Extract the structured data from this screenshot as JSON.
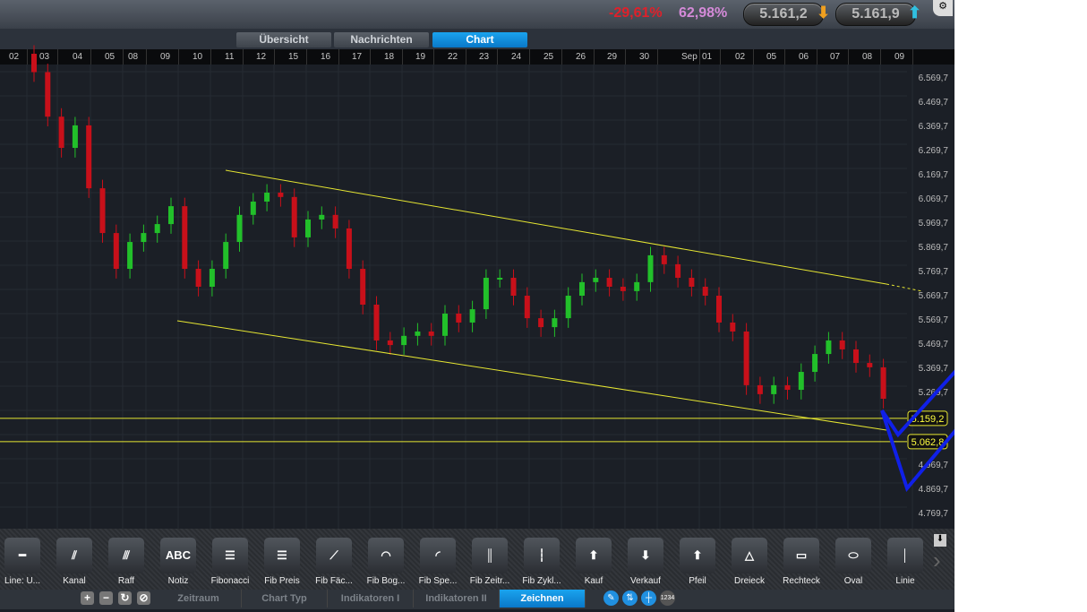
{
  "header": {
    "change_pct": "-29,61%",
    "change_color": "#e0202a",
    "ratio_pct": "62,98%",
    "ratio_color": "#d48ad8",
    "bid": "5.161,2",
    "ask": "5.161,9"
  },
  "tabs": [
    {
      "label": "Übersicht"
    },
    {
      "label": "Nachrichten"
    },
    {
      "label": "Chart",
      "active": true
    }
  ],
  "dates": [
    "02",
    "03",
    "04",
    "05",
    "08",
    "09",
    "10",
    "11",
    "12",
    "15",
    "16",
    "17",
    "18",
    "19",
    "22",
    "23",
    "24",
    "25",
    "26",
    "29",
    "30",
    "Sep",
    "01",
    "02",
    "05",
    "06",
    "07",
    "08",
    "09"
  ],
  "price_axis": [
    "6.569,7",
    "6.469,7",
    "6.369,7",
    "6.269,7",
    "6.169,7",
    "6.069,7",
    "5.969,7",
    "5.869,7",
    "5.769,7",
    "5.669,7",
    "5.569,7",
    "5.469,7",
    "5.369,7",
    "5.269,7",
    "5.169,7",
    "5.069,7",
    "4.969,7",
    "4.869,7",
    "4.769,7"
  ],
  "price_levels": [
    {
      "label": "5.159,2",
      "value": 5159.2
    },
    {
      "label": "5.062,8",
      "value": 5062.8
    }
  ],
  "candle_closes": [
    6666,
    6590,
    6406,
    6277,
    6370,
    6110,
    5925,
    5777,
    5888,
    5925,
    5962,
    6036,
    5777,
    5703,
    5777,
    5888,
    6000,
    6055,
    6092,
    6074,
    5907,
    5981,
    6000,
    5944,
    5777,
    5629,
    5481,
    5462,
    5500,
    5518,
    5500,
    5592,
    5555,
    5610,
    5740,
    5740,
    5666,
    5573,
    5536,
    5573,
    5666,
    5722,
    5740,
    5703,
    5685,
    5722,
    5833,
    5796,
    5740,
    5703,
    5666,
    5555,
    5518,
    5296,
    5259,
    5296,
    5277,
    5351,
    5425,
    5481,
    5444,
    5388,
    5370,
    5240
  ],
  "colors": {
    "up": "#22c02a",
    "down": "#c8101a",
    "trendline": "#e6e632",
    "annotation": "#1020e8"
  },
  "tools": [
    {
      "label": "Line: U...",
      "icon": "horizontal-line-icon",
      "glyph": "━"
    },
    {
      "label": "Kanal",
      "icon": "channel-icon",
      "glyph": "⫽"
    },
    {
      "label": "Raff",
      "icon": "raff-channel-icon",
      "glyph": "⫻"
    },
    {
      "label": "Notiz",
      "icon": "note-icon",
      "glyph": "ABC"
    },
    {
      "label": "Fibonacci",
      "icon": "fibonacci-icon",
      "glyph": "☰"
    },
    {
      "label": "Fib Preis",
      "icon": "fib-price-icon",
      "glyph": "☰"
    },
    {
      "label": "Fib Fäc...",
      "icon": "fib-fan-icon",
      "glyph": "⟋"
    },
    {
      "label": "Fib Bog...",
      "icon": "fib-arc-icon",
      "glyph": "◠"
    },
    {
      "label": "Fib Spe...",
      "icon": "fib-speed-icon",
      "glyph": "◜"
    },
    {
      "label": "Fib Zeitr...",
      "icon": "fib-time-icon",
      "glyph": "║"
    },
    {
      "label": "Fib Zykl...",
      "icon": "fib-cycle-icon",
      "glyph": "┆"
    },
    {
      "label": "Kauf",
      "icon": "buy-arrow-icon",
      "glyph": "⬆"
    },
    {
      "label": "Verkauf",
      "icon": "sell-arrow-icon",
      "glyph": "⬇"
    },
    {
      "label": "Pfeil",
      "icon": "arrow-icon",
      "glyph": "⬆"
    },
    {
      "label": "Dreieck",
      "icon": "triangle-icon",
      "glyph": "△"
    },
    {
      "label": "Rechteck",
      "icon": "rectangle-icon",
      "glyph": "▭"
    },
    {
      "label": "Oval",
      "icon": "oval-icon",
      "glyph": "⬭"
    },
    {
      "label": "Linie",
      "icon": "vertical-line-icon",
      "glyph": "│"
    }
  ],
  "bottom_tabs": [
    {
      "label": "Zeitraum"
    },
    {
      "label": "Chart Typ"
    },
    {
      "label": "Indikatoren I"
    },
    {
      "label": "Indikatoren II"
    },
    {
      "label": "Zeichnen",
      "active": true
    }
  ],
  "bottom_buttons": [
    "+",
    "−",
    "↻",
    "⊘"
  ],
  "bottom_tools_label": "1234"
}
